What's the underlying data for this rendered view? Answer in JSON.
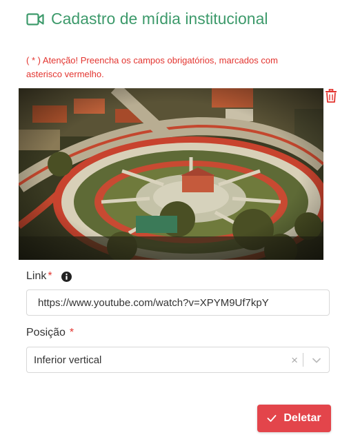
{
  "header": {
    "title": "Cadastro de mídia institucional",
    "icon": "video-camera-icon"
  },
  "warning": {
    "text": "( * ) Atenção! Preencha os campos obrigatórios, marcados com asterisco vermelho."
  },
  "media": {
    "icon_delete": "trash-icon"
  },
  "link_field": {
    "label": "Link",
    "required_mark": "*",
    "value": "https://www.youtube.com/watch?v=XPYM9Uf7kpY",
    "info_icon": "info-icon"
  },
  "position_field": {
    "label": "Posição",
    "required_mark": "*",
    "selected": "Inferior vertical",
    "clear_symbol": "×"
  },
  "actions": {
    "delete_label": "Deletar",
    "delete_icon": "check-icon"
  },
  "colors": {
    "accent": "#3d9a6b",
    "danger": "#e3342f",
    "button": "#e3454b"
  }
}
